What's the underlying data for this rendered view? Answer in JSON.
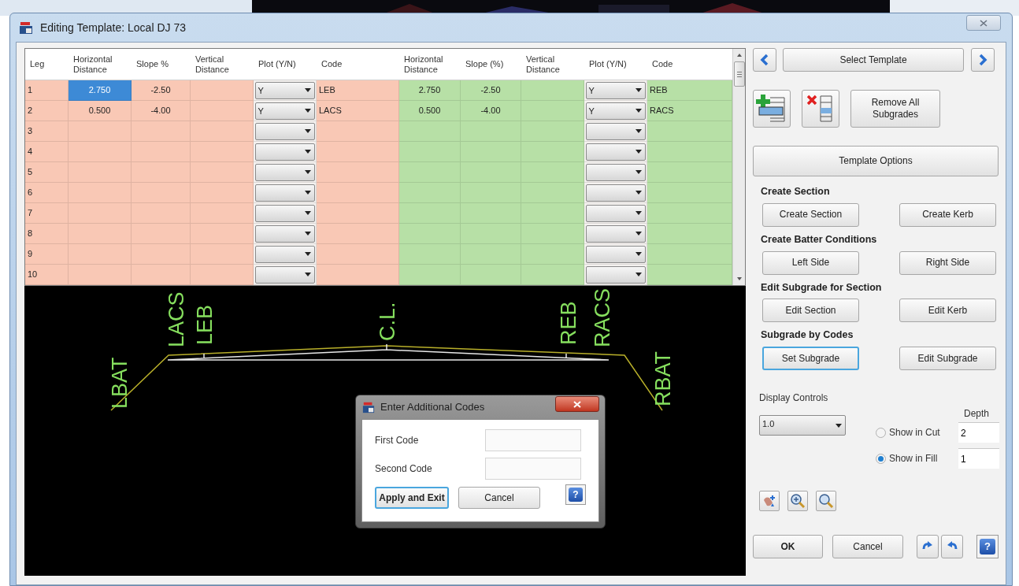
{
  "window": {
    "title": "Editing Template: Local DJ 73"
  },
  "table": {
    "columns": [
      {
        "label": "Leg",
        "kind": "leg",
        "color": "#f9c8b5"
      },
      {
        "label": "Horizontal Distance",
        "kind": "number",
        "color": "#f9c8b5"
      },
      {
        "label": "Slope %",
        "kind": "number",
        "color": "#f9c8b5"
      },
      {
        "label": "Vertical Distance",
        "kind": "number",
        "color": "#f9c8b5"
      },
      {
        "label": "Plot (Y/N)",
        "kind": "dropdown"
      },
      {
        "label": "Code",
        "kind": "code",
        "color": "#f9c8b5"
      },
      {
        "label": "Horizontal Distance",
        "kind": "number",
        "color": "#b7e0a6"
      },
      {
        "label": "Slope (%)",
        "kind": "number",
        "color": "#b7e0a6"
      },
      {
        "label": "Vertical Distance",
        "kind": "number",
        "color": "#b7e0a6"
      },
      {
        "label": "Plot (Y/N)",
        "kind": "dropdown"
      },
      {
        "label": "Code",
        "kind": "code",
        "color": "#b7e0a6"
      }
    ],
    "rows": [
      {
        "cells": [
          {
            "text": "1",
            "selected": false
          },
          {
            "text": "2.750",
            "selected": true
          },
          {
            "text": "-2.50",
            "selected": false
          },
          {
            "selected": false
          },
          {
            "text": "Y",
            "selected": false
          },
          {
            "text": "LEB",
            "selected": false
          },
          {
            "text": "2.750",
            "selected": false
          },
          {
            "text": "-2.50",
            "selected": false
          },
          {
            "selected": false
          },
          {
            "text": "Y",
            "selected": false
          },
          {
            "text": "REB",
            "selected": false
          }
        ]
      },
      {
        "cells": [
          {
            "text": "2",
            "selected": false
          },
          {
            "text": "0.500",
            "selected": false
          },
          {
            "text": "-4.00",
            "selected": false
          },
          {
            "selected": false
          },
          {
            "text": "Y",
            "selected": false
          },
          {
            "text": "LACS",
            "selected": false
          },
          {
            "text": "0.500",
            "selected": false
          },
          {
            "text": "-4.00",
            "selected": false
          },
          {
            "selected": false
          },
          {
            "text": "Y",
            "selected": false
          },
          {
            "text": "RACS",
            "selected": false
          }
        ]
      },
      {
        "cells": [
          {
            "text": "3",
            "selected": false
          },
          {
            "selected": false
          },
          {
            "selected": false
          },
          {
            "selected": false
          },
          {
            "selected": false
          },
          {
            "selected": false
          },
          {
            "selected": false
          },
          {
            "selected": false
          },
          {
            "selected": false
          },
          {
            "selected": false
          },
          {
            "selected": false
          }
        ]
      },
      {
        "cells": [
          {
            "text": "4",
            "selected": false
          },
          {
            "selected": false
          },
          {
            "selected": false
          },
          {
            "selected": false
          },
          {
            "selected": false
          },
          {
            "selected": false
          },
          {
            "selected": false
          },
          {
            "selected": false
          },
          {
            "selected": false
          },
          {
            "selected": false
          },
          {
            "selected": false
          }
        ]
      },
      {
        "cells": [
          {
            "text": "5",
            "selected": false
          },
          {
            "selected": false
          },
          {
            "selected": false
          },
          {
            "selected": false
          },
          {
            "selected": false
          },
          {
            "selected": false
          },
          {
            "selected": false
          },
          {
            "selected": false
          },
          {
            "selected": false
          },
          {
            "selected": false
          },
          {
            "selected": false
          }
        ]
      },
      {
        "cells": [
          {
            "text": "6",
            "selected": false
          },
          {
            "selected": false
          },
          {
            "selected": false
          },
          {
            "selected": false
          },
          {
            "selected": false
          },
          {
            "selected": false
          },
          {
            "selected": false
          },
          {
            "selected": false
          },
          {
            "selected": false
          },
          {
            "selected": false
          },
          {
            "selected": false
          }
        ]
      },
      {
        "cells": [
          {
            "text": "7",
            "selected": false
          },
          {
            "selected": false
          },
          {
            "selected": false
          },
          {
            "selected": false
          },
          {
            "selected": false
          },
          {
            "selected": false
          },
          {
            "selected": false
          },
          {
            "selected": false
          },
          {
            "selected": false
          },
          {
            "selected": false
          },
          {
            "selected": false
          }
        ]
      },
      {
        "cells": [
          {
            "text": "8",
            "selected": false
          },
          {
            "selected": false
          },
          {
            "selected": false
          },
          {
            "selected": false
          },
          {
            "selected": false
          },
          {
            "selected": false
          },
          {
            "selected": false
          },
          {
            "selected": false
          },
          {
            "selected": false
          },
          {
            "selected": false
          },
          {
            "selected": false
          }
        ]
      },
      {
        "cells": [
          {
            "text": "9",
            "selected": false
          },
          {
            "selected": false
          },
          {
            "selected": false
          },
          {
            "selected": false
          },
          {
            "selected": false
          },
          {
            "selected": false
          },
          {
            "selected": false
          },
          {
            "selected": false
          },
          {
            "selected": false
          },
          {
            "selected": false
          },
          {
            "selected": false
          }
        ]
      },
      {
        "cells": [
          {
            "text": "10",
            "selected": false
          },
          {
            "selected": false
          },
          {
            "selected": false
          },
          {
            "selected": false
          },
          {
            "selected": false
          },
          {
            "selected": false
          },
          {
            "selected": false
          },
          {
            "selected": false
          },
          {
            "selected": false
          },
          {
            "selected": false
          },
          {
            "selected": false
          }
        ]
      }
    ]
  },
  "canvas": {
    "labels": [
      "LBAT",
      "LACS",
      "LEB",
      "C.L.",
      "REB",
      "RACS",
      "RBAT"
    ]
  },
  "dialog": {
    "title": "Enter Additional Codes",
    "fields": [
      {
        "label": "First Code"
      },
      {
        "label": "Second Code"
      }
    ],
    "buttons": [
      {
        "label": "Apply and Exit",
        "focused": true
      },
      {
        "label": "Cancel",
        "focused": false
      }
    ],
    "help": "?"
  },
  "side_panel": {
    "select_template": "Select Template",
    "remove_all": "Remove All Subgrades",
    "template_options": "Template Options",
    "sections": [
      {
        "heading": "Create Section",
        "buttons": [
          {
            "label": "Create Section",
            "focused": false
          },
          {
            "label": "Create Kerb",
            "focused": false
          }
        ]
      },
      {
        "heading": "Create Batter Conditions",
        "buttons": [
          {
            "label": "Left Side",
            "focused": false
          },
          {
            "label": "Right Side",
            "focused": false
          }
        ]
      },
      {
        "heading": "Edit Subgrade for Section",
        "buttons": [
          {
            "label": "Edit Section",
            "focused": false
          },
          {
            "label": "Edit Kerb",
            "focused": false
          }
        ]
      },
      {
        "heading": "Subgrade by Codes",
        "buttons": [
          {
            "label": "Set Subgrade",
            "focused": true
          },
          {
            "label": "Edit Subgrade",
            "focused": false
          }
        ]
      }
    ],
    "display_controls": {
      "label": "Display Controls",
      "scale": "1.0",
      "depth_label": "Depth",
      "options": [
        {
          "label": "Show in Cut",
          "selected": false,
          "depth": "2"
        },
        {
          "label": "Show in Fill",
          "selected": true,
          "depth": "1"
        }
      ]
    },
    "footer": {
      "ok": "OK",
      "cancel": "Cancel",
      "help": "?"
    }
  }
}
